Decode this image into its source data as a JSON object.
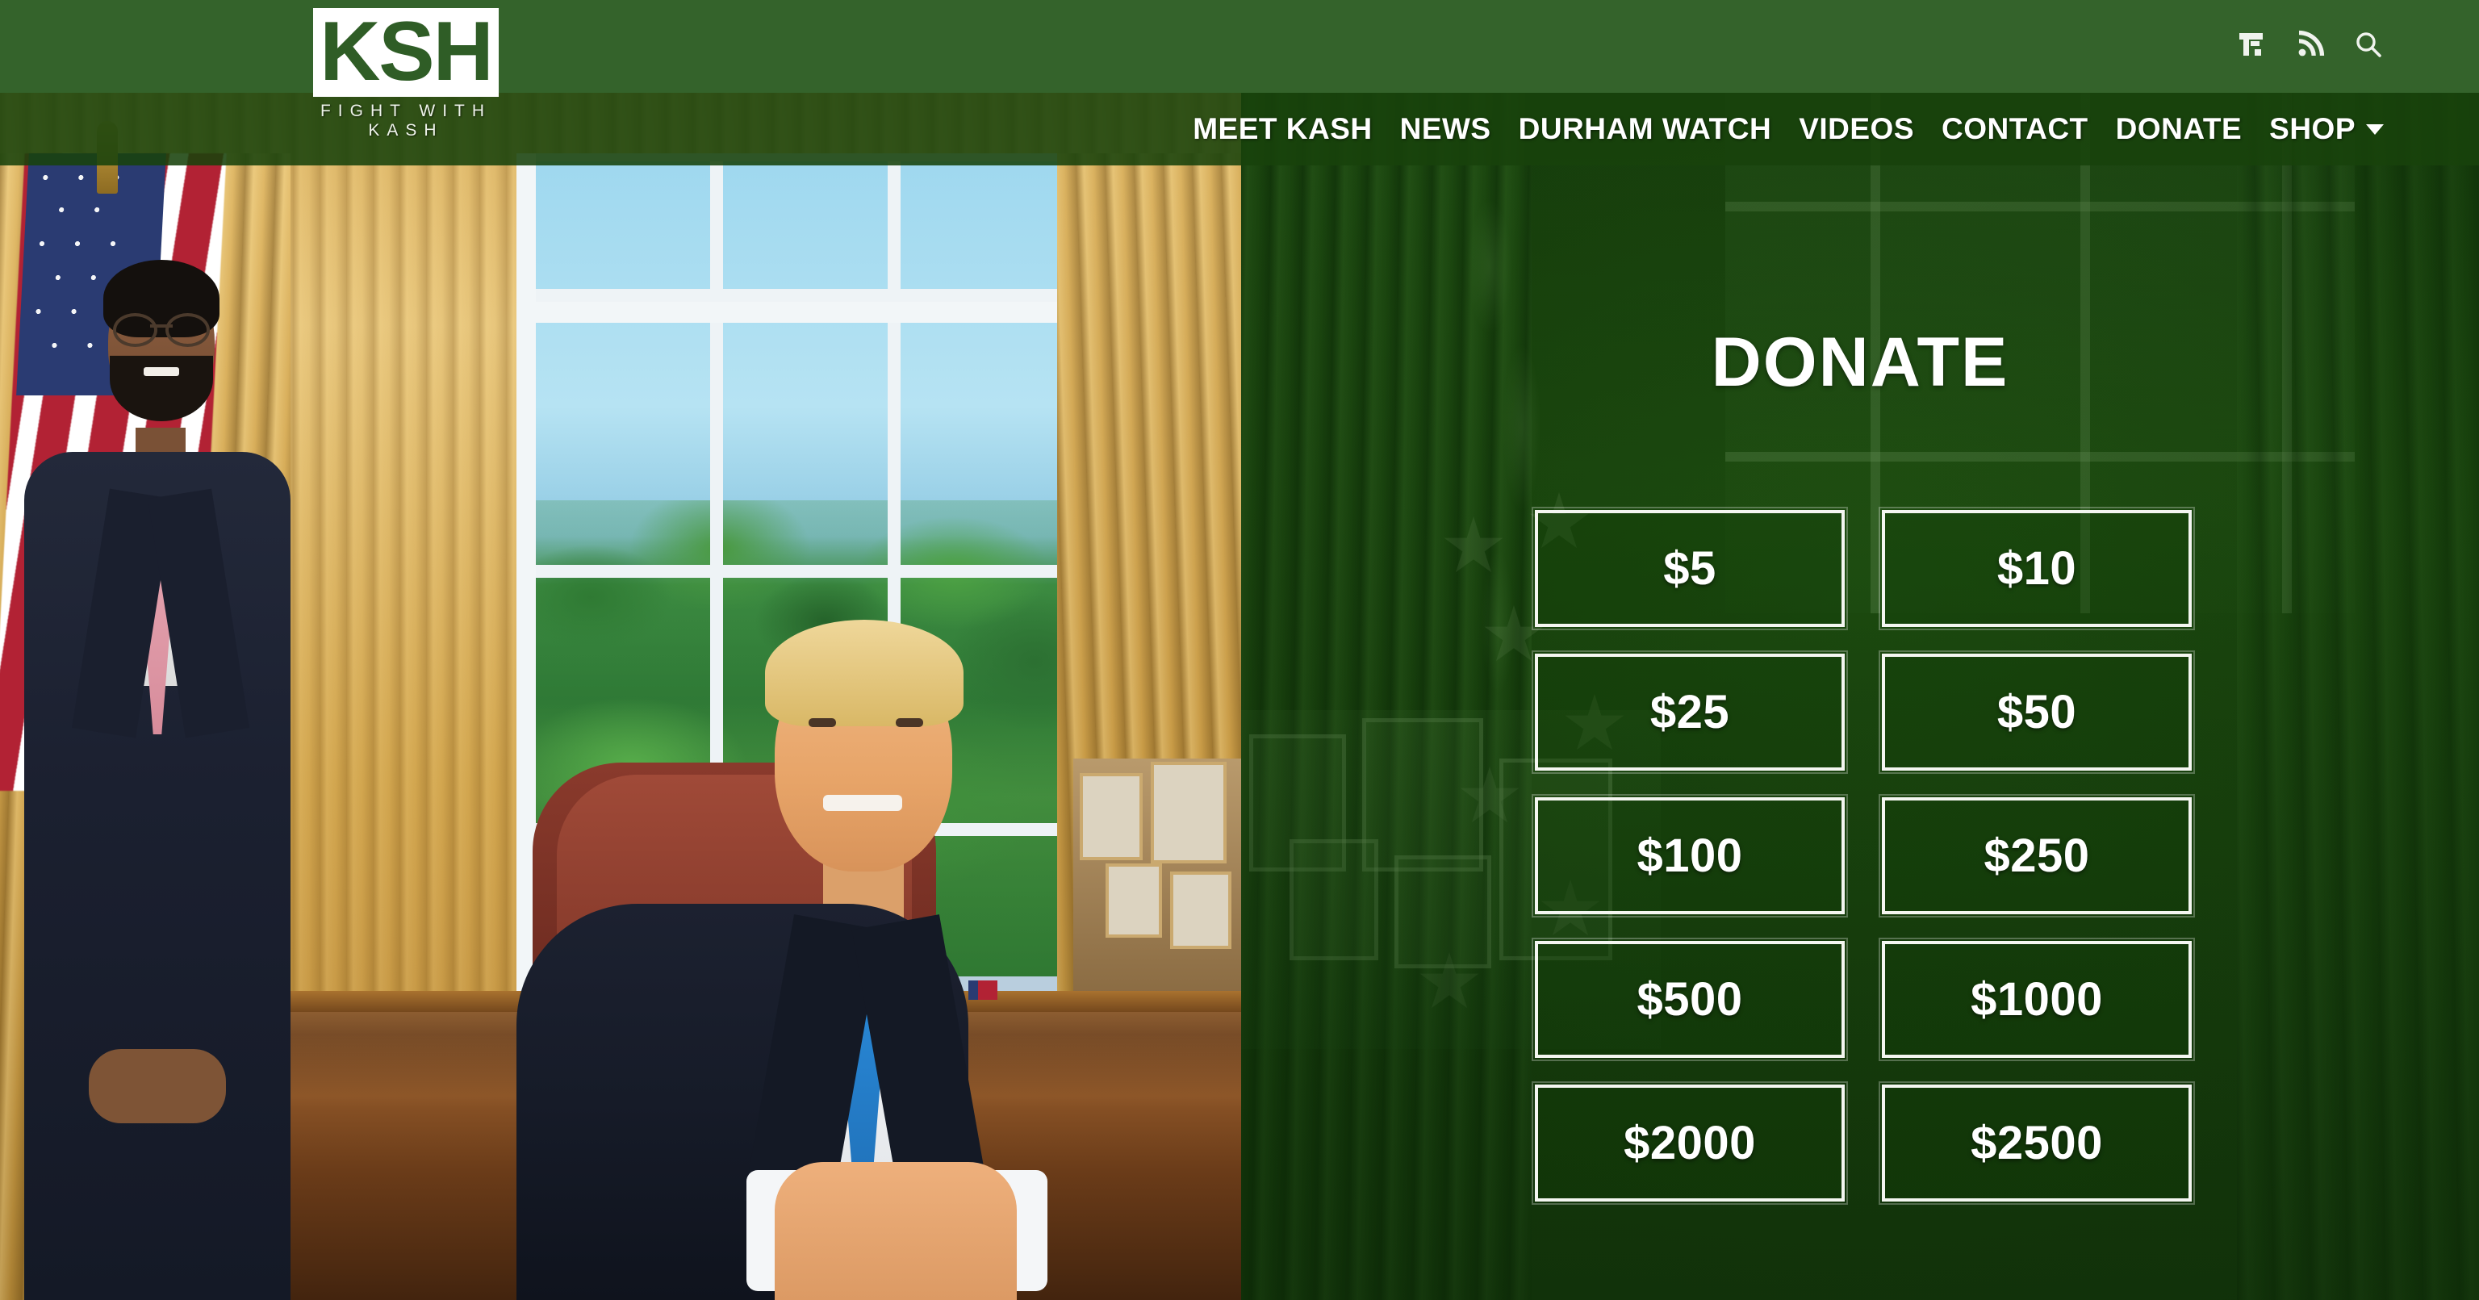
{
  "site": {
    "logo_mark": "KSH",
    "logo_tagline": "FIGHT WITH KASH"
  },
  "header": {
    "icons": [
      {
        "name": "truth-social-icon",
        "label": "Truth Social"
      },
      {
        "name": "rss-icon",
        "label": "RSS Feed"
      },
      {
        "name": "search-icon",
        "label": "Search"
      }
    ]
  },
  "nav": {
    "items": [
      {
        "label": "MEET KASH",
        "has_dropdown": false
      },
      {
        "label": "NEWS",
        "has_dropdown": false
      },
      {
        "label": "DURHAM WATCH",
        "has_dropdown": false
      },
      {
        "label": "VIDEOS",
        "has_dropdown": false
      },
      {
        "label": "CONTACT",
        "has_dropdown": false
      },
      {
        "label": "DONATE",
        "has_dropdown": false
      },
      {
        "label": "SHOP",
        "has_dropdown": true
      }
    ]
  },
  "donate": {
    "title": "DONATE",
    "amounts": [
      "$5",
      "$10",
      "$25",
      "$50",
      "$100",
      "$250",
      "$500",
      "$1000",
      "$2000",
      "$2500"
    ]
  },
  "hero_photo": {
    "description": "Kash Patel standing beside President Donald Trump seated at the Resolute Desk in the Oval Office",
    "alt_subjects": [
      "Kash Patel",
      "Donald Trump"
    ],
    "setting": "Oval Office"
  },
  "colors": {
    "header_green": "#34632B",
    "nav_green": "#18420B",
    "panel_green": "#235812",
    "button_border": "#F4F6F1",
    "text_white": "#FFFFFF"
  }
}
